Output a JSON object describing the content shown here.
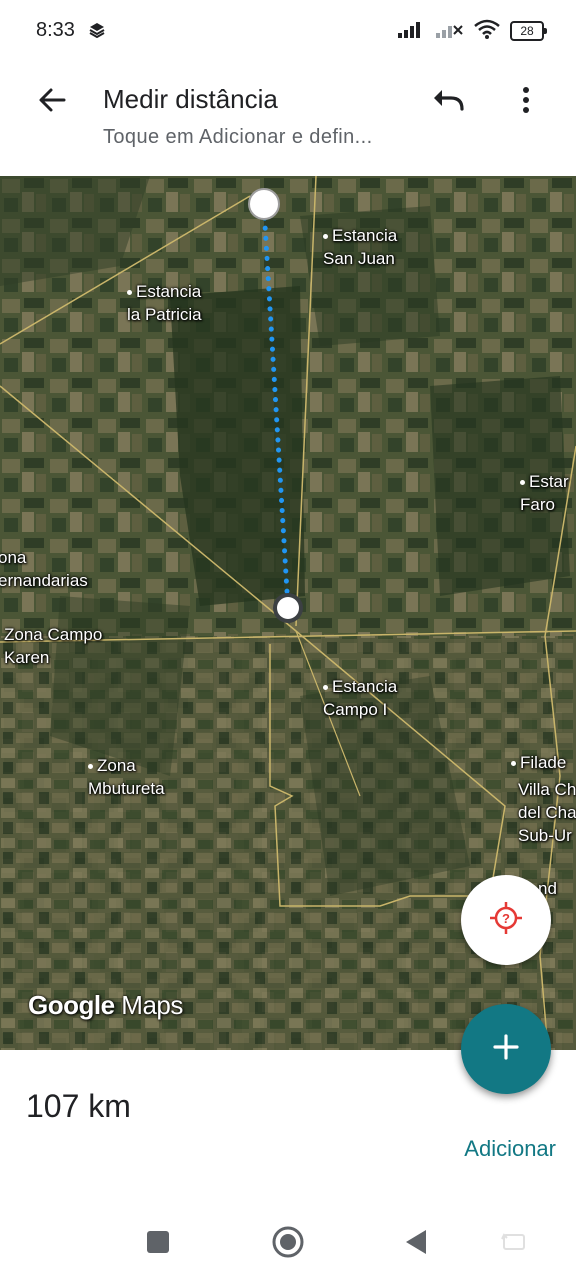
{
  "status_bar": {
    "time": "8:33",
    "battery": "28"
  },
  "toolbar": {
    "title": "Medir distância",
    "subtitle": "Toque em Adicionar e defin..."
  },
  "map": {
    "places": [
      {
        "id": "estancia-san-juan",
        "text": "Estancia\nSan Juan"
      },
      {
        "id": "estancia-la-patricia",
        "text": "Estancia\nla Patricia"
      },
      {
        "id": "estancia-faro",
        "text": "Estar\nFaro"
      },
      {
        "id": "zona-hernandarias",
        "text": "ona\nernandarias"
      },
      {
        "id": "zona-campo-karen",
        "text": "Zona Campo\nKaren"
      },
      {
        "id": "estancia-campo-i",
        "text": "Estancia\nCampo I"
      },
      {
        "id": "zona-mbutureta",
        "text": "Zona\nMbutureta"
      },
      {
        "id": "filadelfia",
        "text": "Filade"
      },
      {
        "id": "villa-chaco",
        "text": "Villa Ch\ndel Cha\nSub-Ur"
      },
      {
        "id": "nd",
        "text": "nd"
      }
    ],
    "logo_google": "Google",
    "logo_maps": "Maps"
  },
  "measurement": {
    "distance": "107 km",
    "add_label": "Adicionar"
  },
  "colors": {
    "accent": "#127884",
    "route": "#2196f3",
    "locate_icon": "#e53935"
  },
  "icons": {
    "back": "arrow-back-icon",
    "undo": "undo-icon",
    "more": "more-vert-icon",
    "locate": "location-unknown-icon",
    "add": "plus-icon"
  }
}
